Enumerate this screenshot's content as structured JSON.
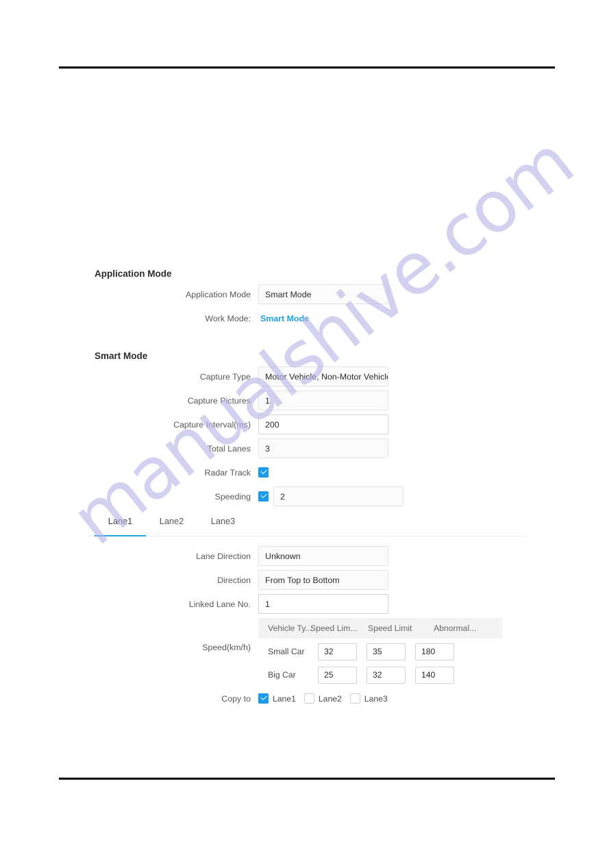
{
  "watermark": {
    "text": "manualshive.com"
  },
  "sections": {
    "application_mode": {
      "title": "Application Mode",
      "fields": {
        "application_mode": {
          "label": "Application Mode",
          "value": "Smart Mode",
          "type": "select"
        },
        "work_mode": {
          "label": "Work Mode:",
          "value": "Smart Mode",
          "type": "static-link"
        }
      }
    },
    "smart_mode": {
      "title": "Smart Mode",
      "fields": {
        "capture_type": {
          "label": "Capture Type",
          "value": "Motor Vehicle, Non-Motor Vehicle",
          "type": "select"
        },
        "capture_pictures": {
          "label": "Capture Pictures",
          "value": "1",
          "type": "select"
        },
        "capture_interval": {
          "label": "Capture Interval(ms)",
          "value": "200",
          "type": "input"
        },
        "total_lanes": {
          "label": "Total Lanes",
          "value": "3",
          "type": "select"
        },
        "radar_track": {
          "label": "Radar Track",
          "checked": true,
          "type": "checkbox"
        },
        "speeding": {
          "label": "Speeding",
          "checked": true,
          "value": "2",
          "type": "checkbox-select"
        }
      }
    }
  },
  "tabs": [
    {
      "label": "Lane1",
      "active": true
    },
    {
      "label": "Lane2",
      "active": false
    },
    {
      "label": "Lane3",
      "active": false
    }
  ],
  "lane_panel": {
    "lane_direction": {
      "label": "Lane Direction",
      "value": "Unknown"
    },
    "direction": {
      "label": "Direction",
      "value": "From Top to Bottom"
    },
    "linked_lane_no": {
      "label": "Linked Lane No.",
      "value": "1"
    },
    "speed_table": {
      "label": "Speed(km/h)",
      "headers": [
        "Vehicle Ty...",
        "Speed Lim...",
        "Speed Limit",
        "Abnormal..."
      ],
      "rows": [
        {
          "name": "Small Car",
          "values": [
            "32",
            "35",
            "180"
          ]
        },
        {
          "name": "Big Car",
          "values": [
            "25",
            "32",
            "140"
          ]
        }
      ]
    },
    "copy_to": {
      "label": "Copy to",
      "options": [
        {
          "label": "Lane1",
          "checked": true
        },
        {
          "label": "Lane2",
          "checked": false
        },
        {
          "label": "Lane3",
          "checked": false
        }
      ]
    }
  },
  "colors": {
    "accent": "#1da1e0",
    "checkbox": "#1b9bec",
    "tab_underline": "#22a4e8",
    "watermark": "#b9b6e8"
  }
}
